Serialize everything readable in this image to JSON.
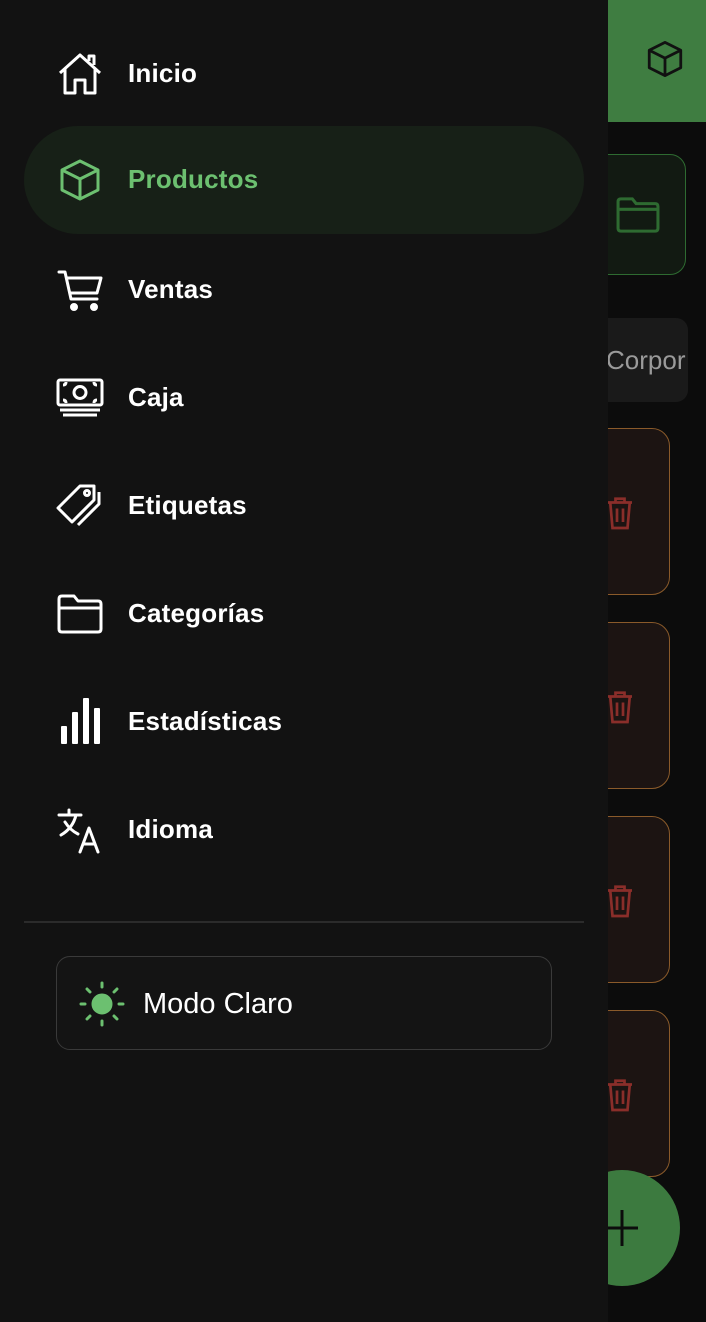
{
  "drawer": {
    "items": [
      {
        "label": "Inicio",
        "icon": "home-icon",
        "active": false
      },
      {
        "label": "Productos",
        "icon": "box-icon",
        "active": true
      },
      {
        "label": "Ventas",
        "icon": "cart-icon",
        "active": false
      },
      {
        "label": "Caja",
        "icon": "cash-icon",
        "active": false
      },
      {
        "label": "Etiquetas",
        "icon": "tag-icon",
        "active": false
      },
      {
        "label": "Categorías",
        "icon": "folder-icon",
        "active": false
      },
      {
        "label": "Estadísticas",
        "icon": "bar-chart-icon",
        "active": false
      },
      {
        "label": "Idioma",
        "icon": "translate-icon",
        "active": false
      }
    ],
    "theme_toggle": {
      "label": "Modo Claro",
      "icon": "sun-icon"
    }
  },
  "background": {
    "appbar_icon": "box-icon",
    "filter_chip_label": "Corpor",
    "folder_button_icon": "folder-icon",
    "card_action_icon": "trash-icon",
    "fab_icon": "plus-icon"
  },
  "colors": {
    "accent": "#6cc070",
    "appbar": "#3f7d41",
    "drawer_bg": "#121212",
    "active_item_bg": "#172017",
    "card_border": "#8a5a2a",
    "trash": "#8a2e2a"
  }
}
